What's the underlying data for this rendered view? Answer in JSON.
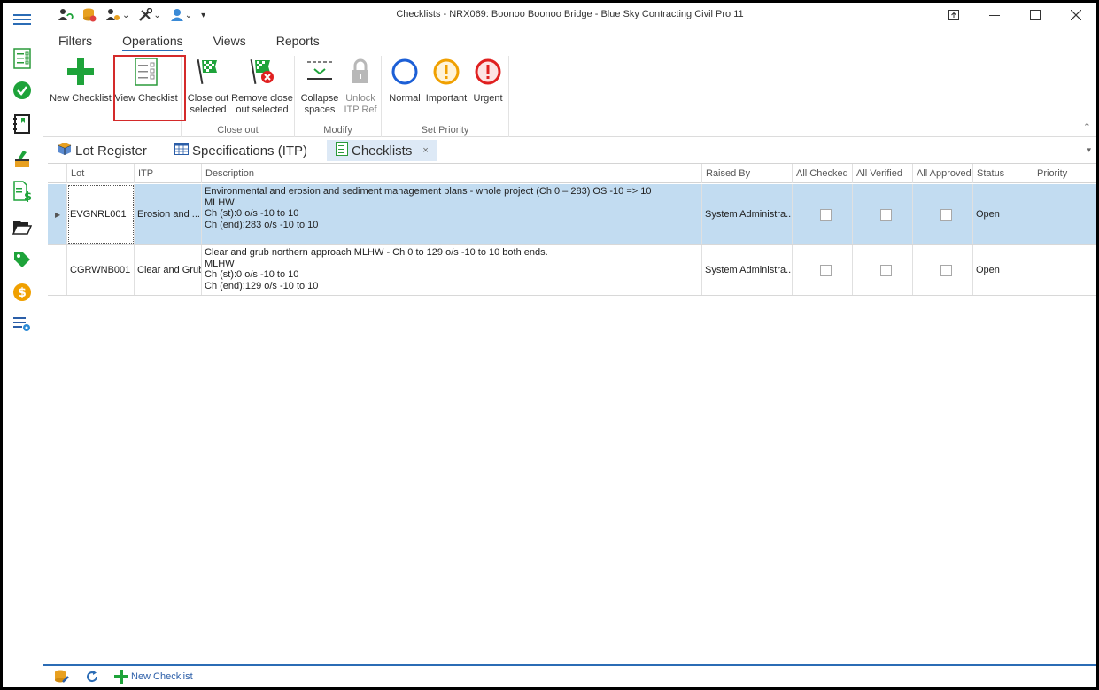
{
  "window": {
    "title": "Checklists - NRX069: Boonoo Boonoo Bridge  - Blue Sky Contracting Civil Pro 11"
  },
  "rail": {
    "items": [
      "menu-icon",
      "checklist-icon",
      "checkmark-icon",
      "notebook-icon",
      "paint-icon",
      "invoice-icon",
      "folder-icon",
      "tag-icon",
      "dollar-icon",
      "settings-list-icon"
    ]
  },
  "ribbon": {
    "tabs": [
      "Filters",
      "Operations",
      "Views",
      "Reports"
    ],
    "active_tab": "Operations",
    "buttons": {
      "new_checklist": "New Checklist",
      "view_checklist": "View Checklist",
      "close_out_1": "Close out",
      "close_out_2": "selected",
      "remove_close_1": "Remove close",
      "remove_close_2": "out selected",
      "collapse_1": "Collapse",
      "collapse_2": "spaces",
      "unlock_1": "Unlock",
      "unlock_2": "ITP Ref",
      "normal": "Normal",
      "important": "Important",
      "urgent": "Urgent"
    },
    "groups": {
      "close_out": "Close out",
      "modify": "Modify",
      "set_priority": "Set Priority"
    }
  },
  "doc_tabs": {
    "lot_register": "Lot Register",
    "specifications": "Specifications (ITP)",
    "checklists": "Checklists",
    "close": "×"
  },
  "grid": {
    "columns": [
      "Lot",
      "ITP",
      "Description",
      "Raised By",
      "All Checked",
      "All Verified",
      "All Approved",
      "Status",
      "Priority"
    ],
    "rows": [
      {
        "lot": "EVGNRL001",
        "itp": "Erosion and ...",
        "desc": [
          "Environmental and erosion and sediment management plans - whole project (Ch 0 – 283) OS -10 => 10",
          "MLHW",
          "Ch (st):0 o/s -10 to 10",
          "Ch (end):283 o/s -10 to 10"
        ],
        "raised_by": "System Administra...",
        "all_checked": false,
        "all_verified": false,
        "all_approved": false,
        "status": "Open",
        "priority": ""
      },
      {
        "lot": "CGRWNB001",
        "itp": "Clear and Grub",
        "desc": [
          "Clear and grub northern approach MLHW - Ch 0 to 129  o/s -10 to 10 both ends.",
          "MLHW",
          "Ch (st):0 o/s -10 to 10",
          "Ch (end):129 o/s -10 to 10"
        ],
        "raised_by": "System Administra...",
        "all_checked": false,
        "all_verified": false,
        "all_approved": false,
        "status": "Open",
        "priority": ""
      }
    ]
  },
  "bottom_bar": {
    "new_checklist": "New Checklist"
  },
  "colors": {
    "accent": "#2b6cb5",
    "selected_row": "#c2dcf1",
    "highlight_box": "#d42a2a",
    "green": "#1ea33a",
    "orange": "#f0a000",
    "red": "#e02020",
    "blue_circle": "#1c5fd6"
  }
}
